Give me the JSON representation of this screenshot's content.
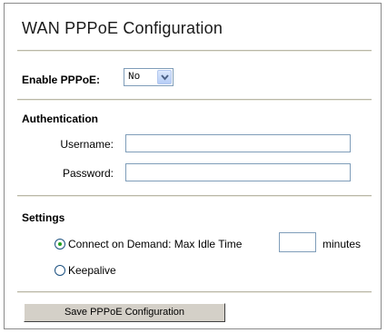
{
  "page": {
    "title": "WAN PPPoE Configuration"
  },
  "enable": {
    "label": "Enable PPPoE:",
    "selected": "No"
  },
  "authentication": {
    "heading": "Authentication",
    "username_label": "Username:",
    "username_value": "",
    "password_label": "Password:",
    "password_value": ""
  },
  "settings": {
    "heading": "Settings",
    "connect_on_demand_label": "Connect on Demand: Max Idle Time",
    "connect_on_demand_selected": true,
    "max_idle_time_value": "",
    "minutes_label": "minutes",
    "keepalive_label": "Keepalive",
    "keepalive_selected": false
  },
  "actions": {
    "save_label": "Save PPPoE Configuration"
  },
  "colors": {
    "separator": "#b9b7a6",
    "input_border": "#7f9db9",
    "radio_dot": "#21a121",
    "button_face": "#d4d0c8"
  }
}
